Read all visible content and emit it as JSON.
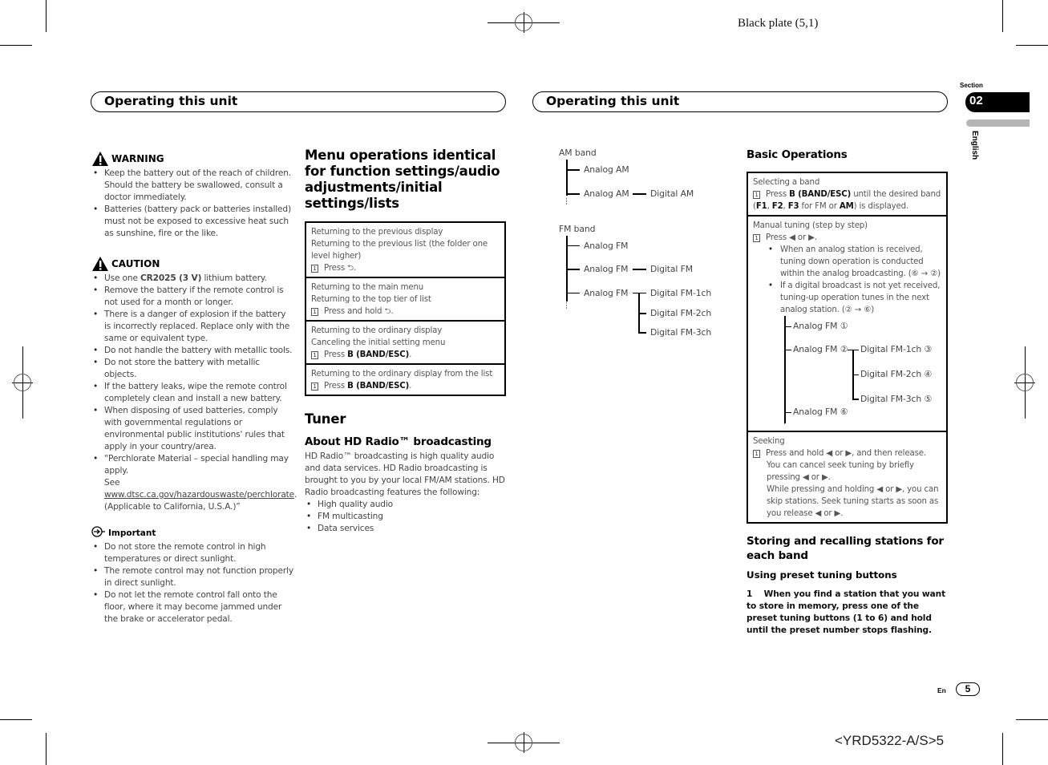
{
  "print": {
    "plate_label": "Black plate (5,1)",
    "doc_code": "<YRD5322-A/S>5"
  },
  "left_page": {
    "header_title": "Operating this unit",
    "warning": {
      "heading": "WARNING",
      "icon": "warning-triangle-icon",
      "items": [
        "Keep the battery out of the reach of children. Should the battery be swallowed, consult a doctor immediately.",
        "Batteries (battery pack or batteries installed) must not be exposed to excessive heat such as sunshine, fire or the like."
      ]
    },
    "caution": {
      "heading": "CAUTION",
      "icon": "warning-triangle-icon",
      "item1_prefix": "Use one ",
      "item1_bold": "CR2025 (3 V)",
      "item1_suffix": " lithium battery.",
      "items": [
        "Remove the battery if the remote control is not used for a month or longer.",
        "There is a danger of explosion if the battery is incorrectly replaced. Replace only with the same or equivalent type.",
        "Do not handle the battery with metallic tools.",
        "Do not store the battery with metallic objects.",
        "If the battery leaks, wipe the remote control completely clean and install a new battery.",
        "When disposing of used batteries, comply with governmental regulations or environmental public institutions' rules that apply in your country/area."
      ],
      "perchlorate_intro": "“Perchlorate Material – special handling may apply.",
      "perchlorate_see": "See ",
      "perchlorate_link": "www.dtsc.ca.gov/hazardouswaste/perchlorate",
      "perchlorate_suffix": ". (Applicable to California, U.S.A.)”"
    },
    "important": {
      "heading": "Important",
      "icon": "important-note-icon",
      "items": [
        "Do not store the remote control in high temperatures or direct sunlight.",
        "The remote control may not function properly in direct sunlight.",
        "Do not let the remote control fall onto the floor, where it may become jammed under the brake or accelerator pedal."
      ]
    },
    "menu_ops": {
      "title": "Menu operations identical for function settings/audio adjustments/initial settings/lists",
      "rows": [
        {
          "lines": [
            "Returning to the previous display",
            "Returning to the previous list (the folder one level higher)"
          ],
          "step_num": "1",
          "step_prefix": "Press ",
          "step_bold": "",
          "step_icon": "return-icon",
          "step_suffix": "."
        },
        {
          "lines": [
            "Returning to the main menu",
            "Returning to the top tier of list"
          ],
          "step_num": "1",
          "step_prefix": "Press and hold ",
          "step_bold": "",
          "step_icon": "return-icon",
          "step_suffix": "."
        },
        {
          "lines": [
            "Returning to the ordinary display",
            "Canceling the initial setting menu"
          ],
          "step_num": "1",
          "step_prefix": "Press ",
          "step_bold": "B (BAND/ESC)",
          "step_icon": "",
          "step_suffix": "."
        },
        {
          "lines": [
            "Returning to the ordinary display from the list"
          ],
          "step_num": "1",
          "step_prefix": "Press ",
          "step_bold": "B (BAND/ESC)",
          "step_icon": "",
          "step_suffix": "."
        }
      ]
    },
    "tuner": {
      "title": "Tuner",
      "hd_title": "About HD Radio™ broadcasting",
      "hd_body": "HD Radio™ broadcasting is high quality audio and data services. HD Radio broadcasting is brought to you by your local FM/AM stations. HD Radio broadcasting features the following:",
      "features": [
        "High quality audio",
        "FM multicasting",
        "Data services"
      ]
    }
  },
  "right_page": {
    "header_title": "Operating this unit",
    "section_label": "Section",
    "section_number": "02",
    "language": "English",
    "am_tree": {
      "root": "AM band",
      "analog1": "Analog AM",
      "analog2": "Analog AM",
      "digital": "Digital AM"
    },
    "fm_tree": {
      "root": "FM band",
      "analog1": "Analog FM",
      "analog2": "Analog FM",
      "digital": "Digital FM",
      "analog3": "Analog FM",
      "ch1": "Digital FM-1ch",
      "ch2": "Digital FM-2ch",
      "ch3": "Digital FM-3ch"
    },
    "basic_ops": {
      "title": "Basic Operations",
      "select_band": {
        "label": "Selecting a band",
        "step_num": "1",
        "step_prefix": "Press ",
        "step_bold": "B (BAND/ESC)",
        "step_mid": " until the desired band (",
        "f1": "F1",
        "f2": "F2",
        "f3": "F3",
        "for_fm": " for FM or ",
        "am": "AM",
        "end": ") is displayed."
      },
      "manual": {
        "label": "Manual tuning (step by step)",
        "step_num": "1",
        "step_text": "Press ◀ or ▶.",
        "bullets": [
          "When an analog station is received, tuning down operation is conducted within the analog broadcasting. (⑥ → ②)",
          "If a digital broadcast is not yet received, tuning-up operation tunes in the next analog station. (② → ⑥)"
        ],
        "tree": {
          "a1": "Analog FM ①",
          "a2": "Analog FM ②",
          "d1": "Digital FM-1ch ③",
          "d2": "Digital FM-2ch ④",
          "d3": "Digital FM-3ch ⑤",
          "a6": "Analog FM ⑥"
        }
      },
      "seeking": {
        "label": "Seeking",
        "step_num": "1",
        "lines": [
          "Press and hold ◀ or ▶, and then release.",
          "You can cancel seek tuning by briefly pressing ◀ or ▶.",
          "While pressing and holding ◀ or ▶, you can skip stations. Seek tuning starts as soon as you release ◀ or ▶."
        ]
      }
    },
    "storing": {
      "title": "Storing and recalling stations for each band",
      "subtitle": "Using preset tuning buttons",
      "step_number": "1",
      "step_text": "When you find a station that you want to store in memory, press one of the preset tuning buttons (1 to 6) and hold until the preset number stops flashing."
    },
    "footer": {
      "lang": "En",
      "page_number": "5"
    }
  }
}
